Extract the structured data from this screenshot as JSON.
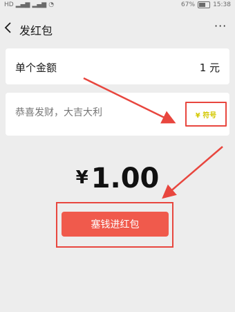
{
  "status_bar": {
    "left_badge": "HD",
    "battery_percent": "67%",
    "time": "15:38"
  },
  "header": {
    "title": "发红包",
    "more": "···"
  },
  "amount_row": {
    "label": "单个金额",
    "value": "1 元"
  },
  "blessing_row": {
    "placeholder": "恭喜发财，大吉大利",
    "emoji_label": "¥ 符号"
  },
  "total": {
    "currency": "¥",
    "value": "1.00"
  },
  "send_button": {
    "label": "塞钱进红包"
  },
  "colors": {
    "accent": "#f05a4c",
    "annotation_red": "#e8463e",
    "background": "#ededed"
  }
}
